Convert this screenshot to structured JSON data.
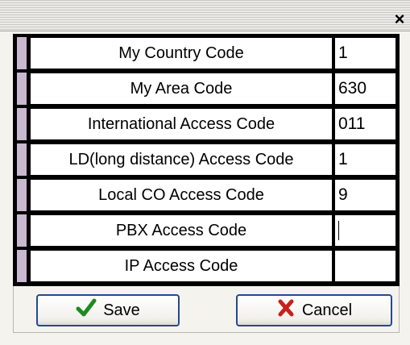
{
  "window": {
    "close_label": "×"
  },
  "rows": [
    {
      "label": "My Country Code",
      "value": "1"
    },
    {
      "label": "My Area Code",
      "value": "630"
    },
    {
      "label": "International Access Code",
      "value": "011"
    },
    {
      "label": "LD(long distance) Access Code",
      "value": "1"
    },
    {
      "label": "Local CO Access Code",
      "value": "9"
    },
    {
      "label": "PBX Access Code",
      "value": ""
    },
    {
      "label": "IP Access Code",
      "value": ""
    }
  ],
  "buttons": {
    "save": {
      "label": "Save",
      "icon": "check-icon",
      "icon_color": "#1e8a1e"
    },
    "cancel": {
      "label": "Cancel",
      "icon": "x-icon",
      "icon_color": "#c8201c"
    }
  }
}
